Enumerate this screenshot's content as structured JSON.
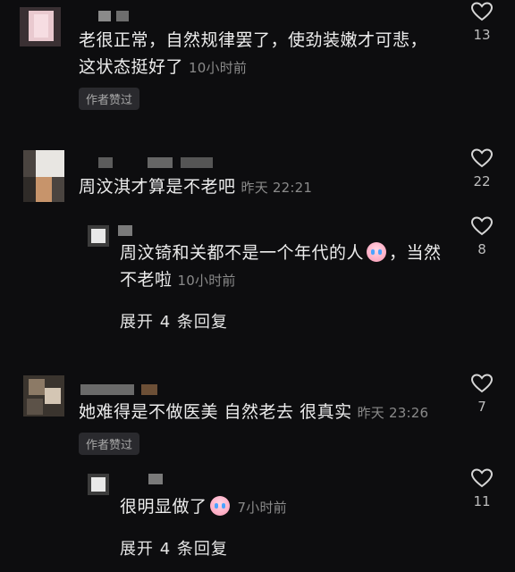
{
  "comments": [
    {
      "text": "老很正常，自然规律罢了，使劲装嫩才可悲，这状态挺好了",
      "line1": "老很正常，自然规律罢了，使劲装嫩才可悲，",
      "line2": "这状态挺好了",
      "time": "10小时前",
      "badge": "作者赞过",
      "likes": "13"
    },
    {
      "text": "周汶淇才算是不老吧",
      "time": "昨天 22:21",
      "likes": "22",
      "reply": {
        "line1_before_emoji": "周汶锜和关都不是一个年代的人",
        "line1_after_emoji": "，当然",
        "line2": "不老啦",
        "time": "10小时前",
        "likes": "8",
        "expand": "展开 4 条回复"
      }
    },
    {
      "text": "她难得是不做医美 自然老去 很真实",
      "time": "昨天 23:26",
      "badge": "作者赞过",
      "likes": "7",
      "reply": {
        "text": "很明显做了",
        "time": "7小时前",
        "likes": "11",
        "expand": "展开 4 条回复"
      }
    }
  ],
  "icons": {
    "like": "heart-outline-icon",
    "emoji": "crying-laughing-emoji-icon"
  },
  "colors": {
    "background": "#0d0d0f",
    "text": "#ececec",
    "meta": "#8a8a8a",
    "badge_bg": "#2a2a2e"
  }
}
